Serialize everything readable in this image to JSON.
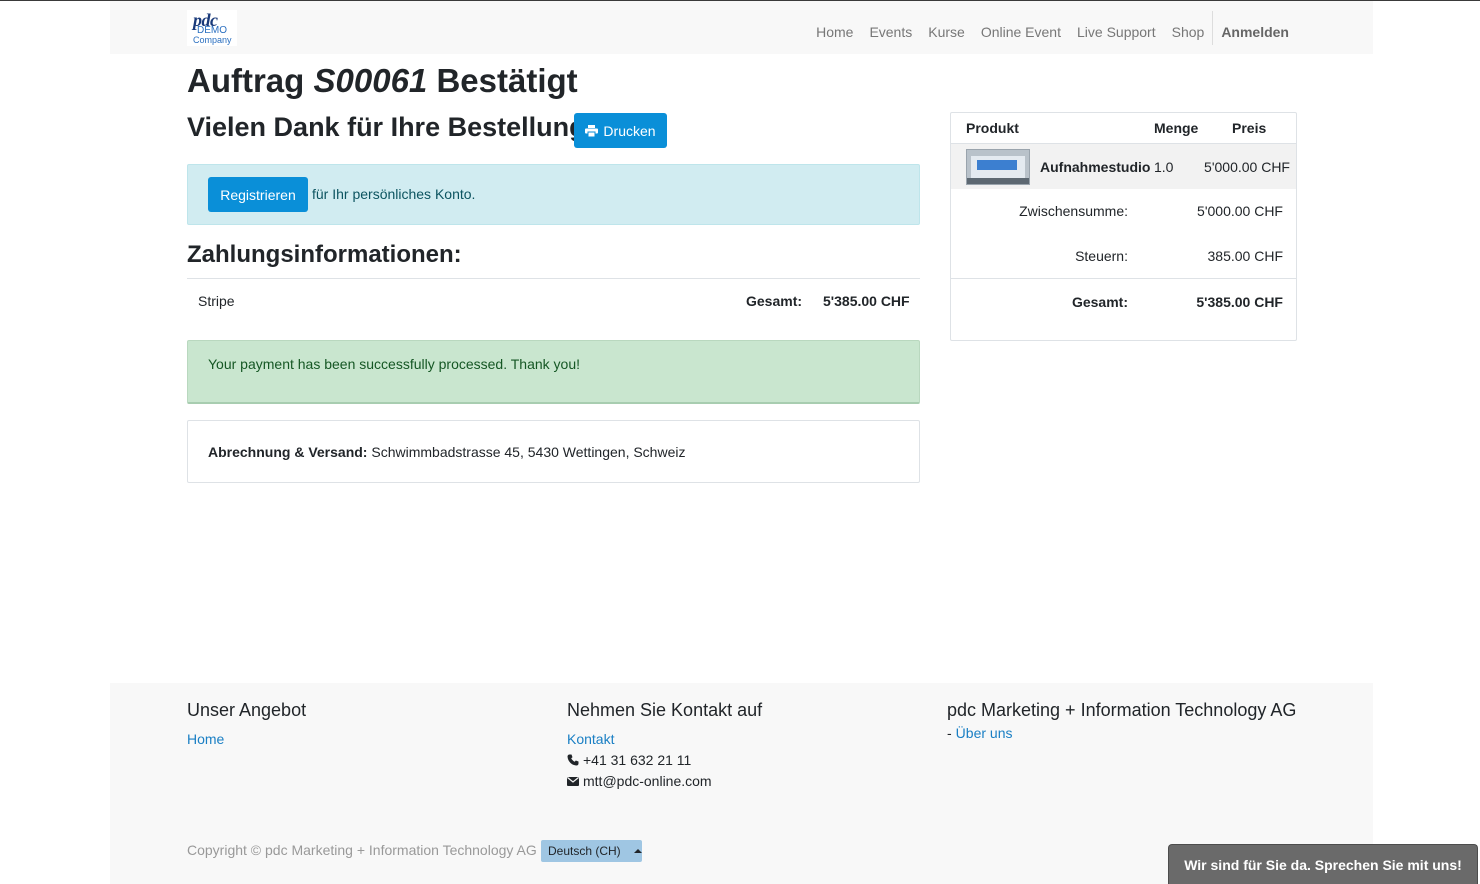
{
  "logo": {
    "line1": "pdc",
    "line2": "DEMO",
    "line3": "Company"
  },
  "nav": {
    "items": [
      "Home",
      "Events",
      "Kurse",
      "Online Event",
      "Live Support",
      "Shop"
    ],
    "login": "Anmelden"
  },
  "order": {
    "title_prefix": "Auftrag",
    "number": "S00061",
    "title_suffix": "Bestätigt",
    "thanks": "Vielen Dank für Ihre Bestellung",
    "print_label": "Drucken"
  },
  "register": {
    "button": "Registrieren",
    "text": "für Ihr persönliches Konto."
  },
  "payment": {
    "heading": "Zahlungsinformationen:",
    "method": "Stripe",
    "total_label": "Gesamt:",
    "total_value": "5'385.00 CHF",
    "success": "Your payment has been successfully processed. Thank you!"
  },
  "address": {
    "label": "Abrechnung & Versand:",
    "value": "Schwimmbadstrasse 45, 5430 Wettingen, Schweiz"
  },
  "summary": {
    "headers": {
      "product": "Produkt",
      "qty": "Menge",
      "price": "Preis"
    },
    "item": {
      "name": "Aufnahmestudio",
      "qty": "1.0",
      "price": "5'000.00 CHF"
    },
    "subtotal_label": "Zwischensumme:",
    "subtotal_value": "5'000.00 CHF",
    "tax_label": "Steuern:",
    "tax_value": "385.00 CHF",
    "total_label": "Gesamt:",
    "total_value": "5'385.00 CHF"
  },
  "footer": {
    "col1_title": "Unser Angebot",
    "col1_link": "Home",
    "col2_title": "Nehmen Sie Kontakt auf",
    "col2_link": "Kontakt",
    "phone": "+41 31 632 21 11",
    "email": "mtt@pdc-online.com",
    "col3_title": "pdc Marketing + Information Technology AG",
    "col3_prefix": "-",
    "col3_link": "Über uns",
    "copyright": "Copyright © pdc Marketing + Information Technology AG",
    "language": "Deutsch (CH)"
  },
  "chat": "Wir sind für Sie da. Sprechen Sie mit uns!",
  "colors": {
    "primary": "#0a8fd8",
    "info_bg": "#d1ecf1",
    "success_bg": "#c9e6cf",
    "link": "#1a7fc4"
  }
}
